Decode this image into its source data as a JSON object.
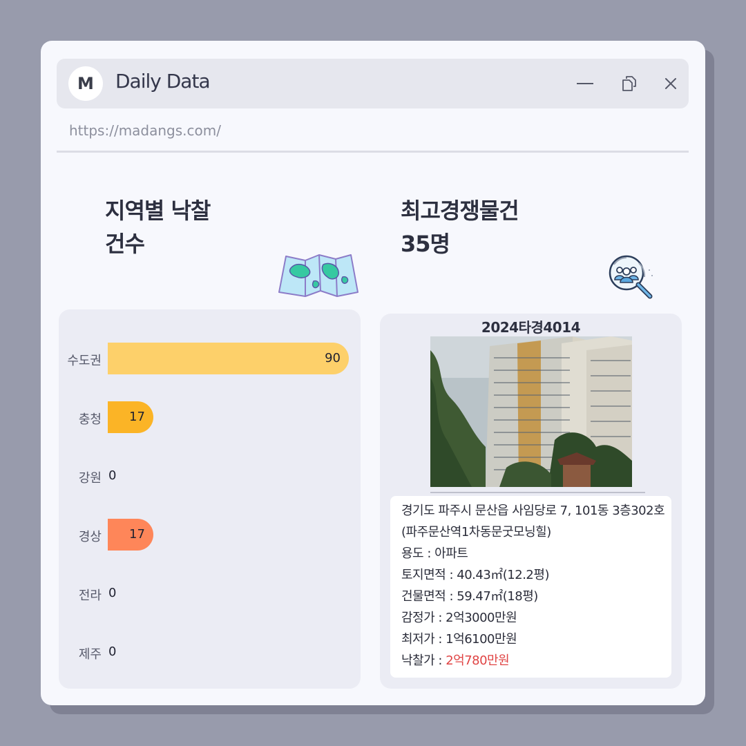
{
  "window": {
    "avatar_letter": "M",
    "title": "Daily Data",
    "url": "https://madangs.com/",
    "controls": [
      "minimize-icon",
      "restore-icon",
      "close-icon"
    ]
  },
  "left": {
    "heading_line1": "지역별 낙찰",
    "heading_line2": "건수",
    "icon": "map-icon"
  },
  "right": {
    "heading_line1": "최고경쟁물건",
    "heading_line2": "35명",
    "icon": "people-search-icon"
  },
  "chart_data": {
    "type": "bar",
    "orientation": "horizontal",
    "categories": [
      "수도권",
      "충청",
      "강원",
      "경상",
      "전라",
      "제주"
    ],
    "values": [
      90,
      17,
      0,
      17,
      0,
      0
    ],
    "colors": [
      "#fdd06a",
      "#fbb426",
      "#fbb426",
      "#fe8659",
      "#fe8659",
      "#fe8659"
    ],
    "xlim": [
      0,
      90
    ]
  },
  "property": {
    "case_no": "2024타경4014",
    "address": "경기도 파주시 문산읍 사임당로 7, 101동 3층302호",
    "complex": "(파주문산역1차동문굿모닝힐)",
    "usage": "용도 : 아파트",
    "land_area": "토지면적 : 40.43㎡(12.2평)",
    "building_area": "건물면적 : 59.47㎡(18평)",
    "appraisal": "감정가 : 2억3000만원",
    "minimum": "최저가 : 1억6100만원",
    "winning_label": "낙찰가 : ",
    "winning_value": "2억780만원",
    "winning_color": "#e04444"
  }
}
